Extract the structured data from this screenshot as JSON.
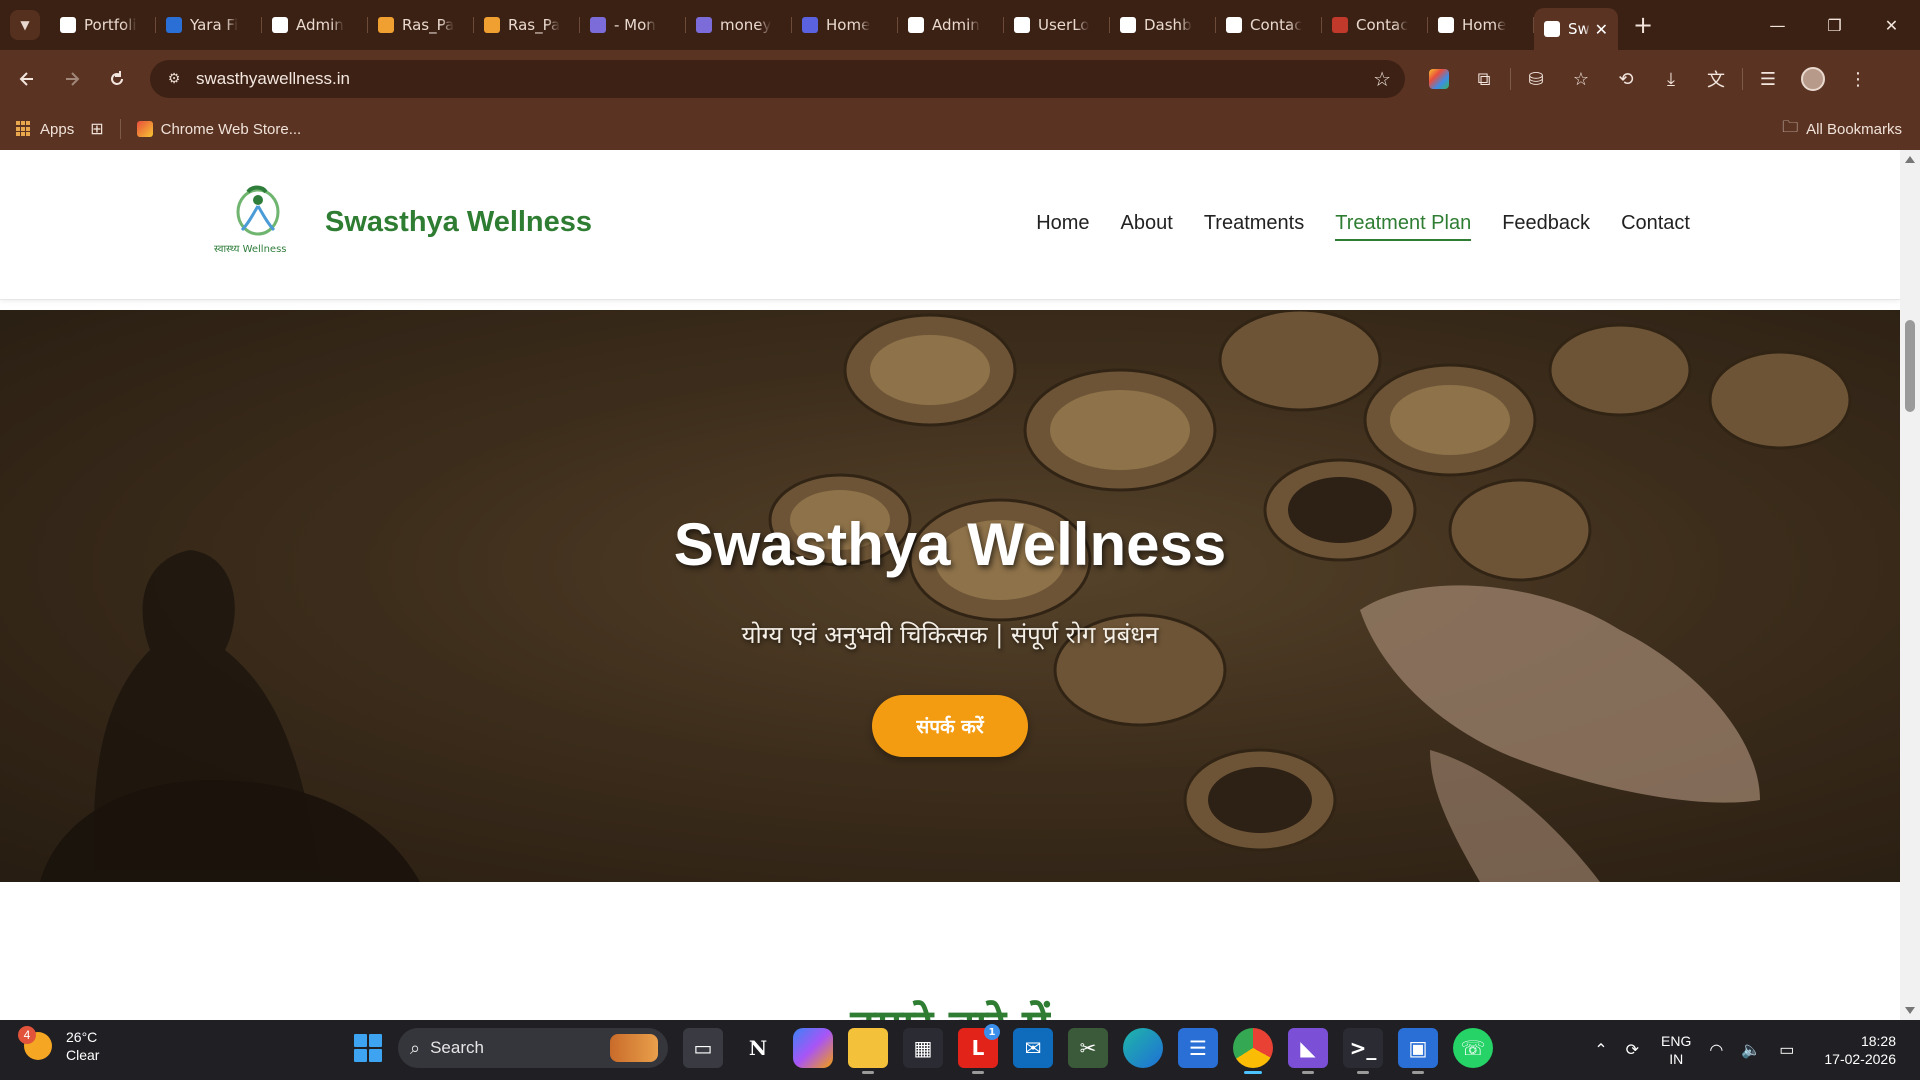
{
  "browser": {
    "tabs": [
      {
        "title": "Portfoli",
        "color": "#ffffff"
      },
      {
        "title": "Yara Fi",
        "color": "#2a6fd6"
      },
      {
        "title": "Admin",
        "color": "#ffffff"
      },
      {
        "title": "Ras_Pa",
        "color": "#f0a030"
      },
      {
        "title": "Ras_Pa",
        "color": "#f0a030"
      },
      {
        "title": "- Mon",
        "color": "#7b6cd9"
      },
      {
        "title": "money",
        "color": "#7b6cd9"
      },
      {
        "title": "Home",
        "color": "#5a62e0"
      },
      {
        "title": "Admin",
        "color": "#ffffff"
      },
      {
        "title": "UserLo",
        "color": "#ffffff"
      },
      {
        "title": "Dashb",
        "color": "#ffffff"
      },
      {
        "title": "Contac",
        "color": "#ffffff"
      },
      {
        "title": "Contac",
        "color": "#c0392b"
      },
      {
        "title": "Home",
        "color": "#ffffff"
      }
    ],
    "active_tab": {
      "title": "Sw",
      "close": "✕"
    },
    "new_tab": "+",
    "window_controls": {
      "minimize": "—",
      "restore": "❐",
      "close": "✕"
    },
    "url": "swasthyawellness.in",
    "bookmarks": {
      "apps": "Apps",
      "chrome_web_store": "Chrome Web Store...",
      "all_bookmarks": "All Bookmarks"
    }
  },
  "site": {
    "brand": "Swasthya Wellness",
    "logo_text": "स्वास्थ्य Wellness",
    "nav": [
      {
        "label": "Home",
        "current": false
      },
      {
        "label": "About",
        "current": false
      },
      {
        "label": "Treatments",
        "current": false
      },
      {
        "label": "Treatment Plan",
        "current": true
      },
      {
        "label": "Feedback",
        "current": false
      },
      {
        "label": "Contact",
        "current": false
      }
    ],
    "hero": {
      "title": "Swasthya Wellness",
      "subtitle": "योग्य एवं अनुभवी चिकित्सक | संपूर्ण रोग प्रबंधन",
      "cta": "संपर्क करें"
    },
    "next_section_title": "हमारे बारे में",
    "colors": {
      "primary_green": "#2e7d32",
      "cta_orange": "#f39c12"
    }
  },
  "taskbar": {
    "weather": {
      "temp": "26°C",
      "condition": "Clear",
      "badge": "4"
    },
    "search_placeholder": "Search",
    "apps": [
      {
        "name": "task-view",
        "badge": ""
      },
      {
        "name": "notion",
        "badge": ""
      },
      {
        "name": "copilot",
        "badge": ""
      },
      {
        "name": "file-explorer",
        "badge": ""
      },
      {
        "name": "microsoft-store",
        "badge": ""
      },
      {
        "name": "lenovo",
        "badge": "1"
      },
      {
        "name": "outlook",
        "badge": ""
      },
      {
        "name": "snipping-tool",
        "badge": ""
      },
      {
        "name": "edge",
        "badge": ""
      },
      {
        "name": "notepad",
        "badge": ""
      },
      {
        "name": "chrome",
        "badge": ""
      },
      {
        "name": "visual-studio",
        "badge": ""
      },
      {
        "name": "terminal",
        "badge": ""
      },
      {
        "name": "remote-desktop",
        "badge": ""
      },
      {
        "name": "whatsapp",
        "badge": ""
      }
    ],
    "language": {
      "line1": "ENG",
      "line2": "IN"
    },
    "time": "18:28",
    "date": "17-02-2026"
  }
}
